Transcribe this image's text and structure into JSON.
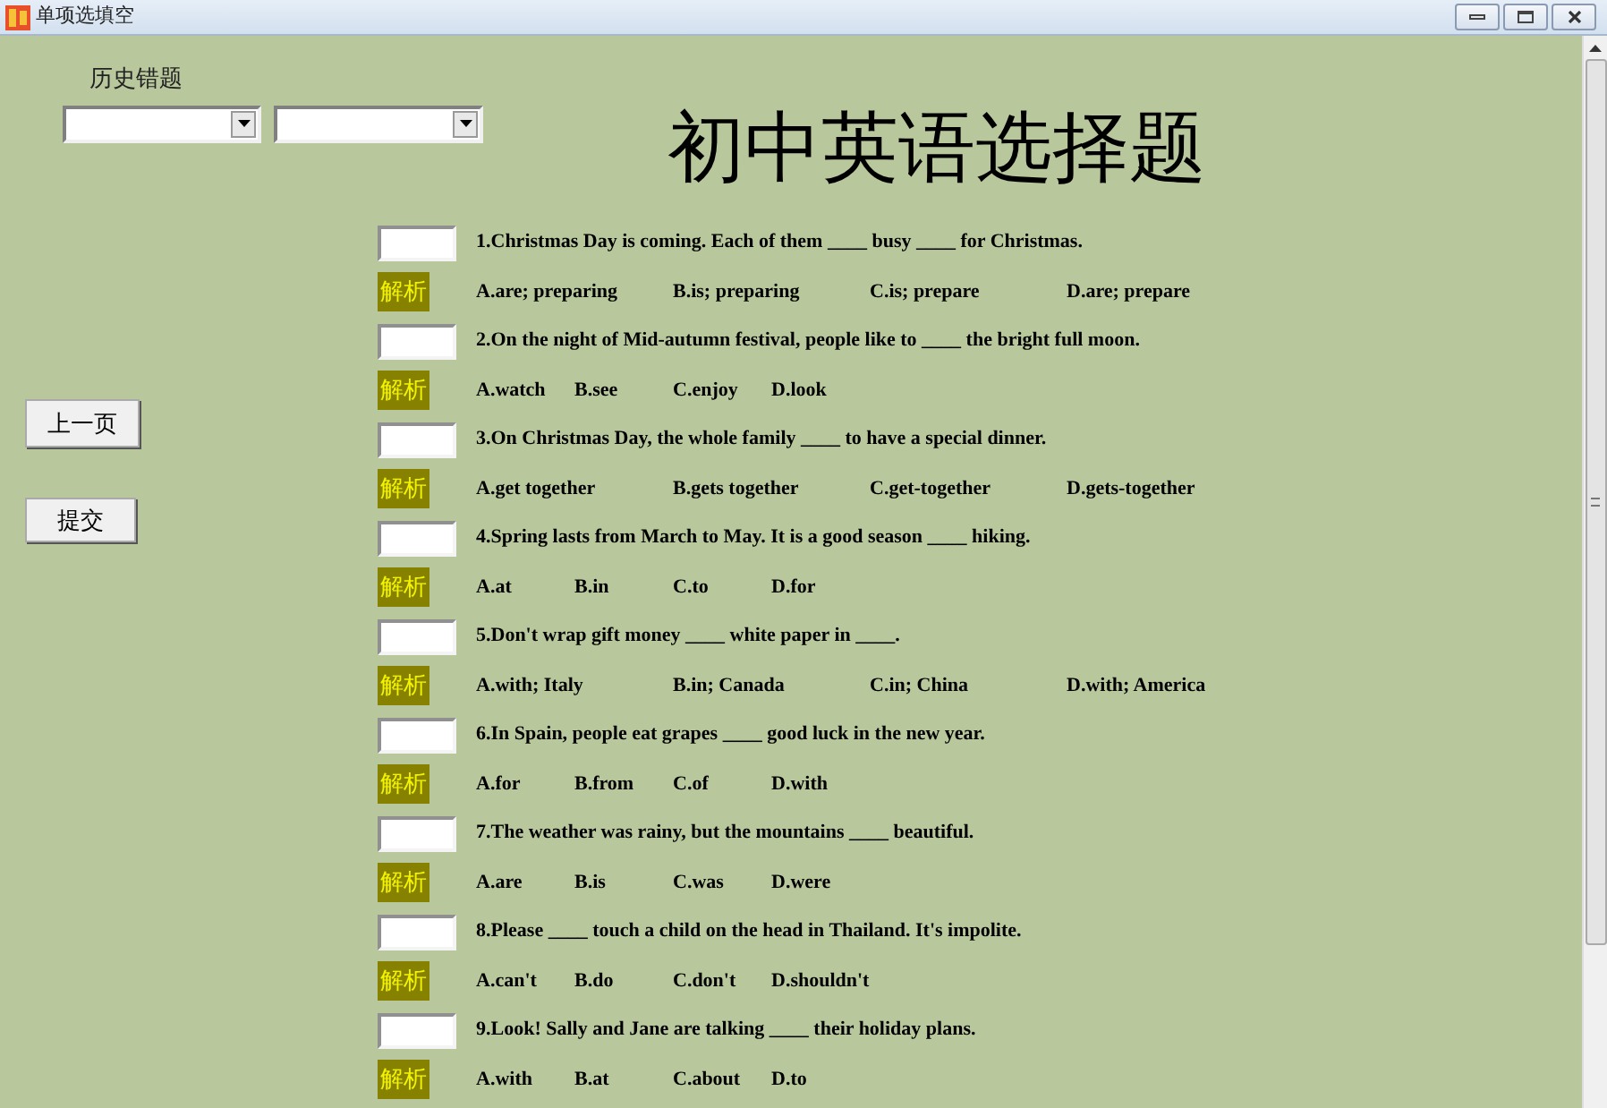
{
  "window": {
    "title": "单项选填空"
  },
  "history": {
    "label": "历史错题",
    "dropdowns": [
      {
        "kind": "dropdown"
      },
      {
        "kind": "dropdown"
      }
    ]
  },
  "buttons": [
    {
      "label": "上一页"
    },
    {
      "label": "提交"
    }
  ],
  "title": "初中英语选择题",
  "questions": [
    {
      "text": "1.Christmas Day is coming. Each of them ____ busy ____ for Christmas.",
      "explain": "解析",
      "options": [
        "A.are; preparing",
        "B.is; preparing",
        "C.is; prepare",
        "D.are; prepare"
      ]
    },
    {
      "text": "2.On the night of Mid-autumn festival, people like to ____ the bright full moon.",
      "explain": "解析",
      "options": [
        "A.watch",
        "B.see",
        "C.enjoy",
        "D.look"
      ]
    },
    {
      "text": "3.On Christmas Day, the whole family ____ to have a special dinner.",
      "explain": "解析",
      "options": [
        "A.get together",
        "B.gets together",
        "C.get-together",
        "D.gets-together"
      ]
    },
    {
      "text": "4.Spring lasts from March to May. It is a good season ____ hiking.",
      "explain": "解析",
      "options": [
        "A.at",
        "B.in",
        "C.to",
        "D.for"
      ]
    },
    {
      "text": "5.Don't wrap gift money ____ white paper in ____.",
      "explain": "解析",
      "options": [
        "A.with; Italy",
        "B.in; Canada",
        "C.in; China",
        "D.with; America"
      ]
    },
    {
      "text": "6.In Spain, people eat grapes ____ good luck in the new year.",
      "explain": "解析",
      "options": [
        "A.for",
        "B.from",
        "C.of",
        "D.with"
      ]
    },
    {
      "text": "7.The weather was rainy, but the mountains ____ beautiful.",
      "explain": "解析",
      "options": [
        "A.are",
        "B.is",
        "C.was",
        "D.were"
      ]
    },
    {
      "text": "8.Please ____ touch a child on the head in Thailand. It's impolite.",
      "explain": "解析",
      "options": [
        "A.can't",
        "B.do",
        "C.don't",
        "D.shouldn't"
      ]
    },
    {
      "text": "9.Look! Sally and Jane are talking ____ their holiday plans.",
      "explain": "解析",
      "options": [
        "A.with",
        "B.at",
        "C.about",
        "D.to"
      ]
    }
  ]
}
